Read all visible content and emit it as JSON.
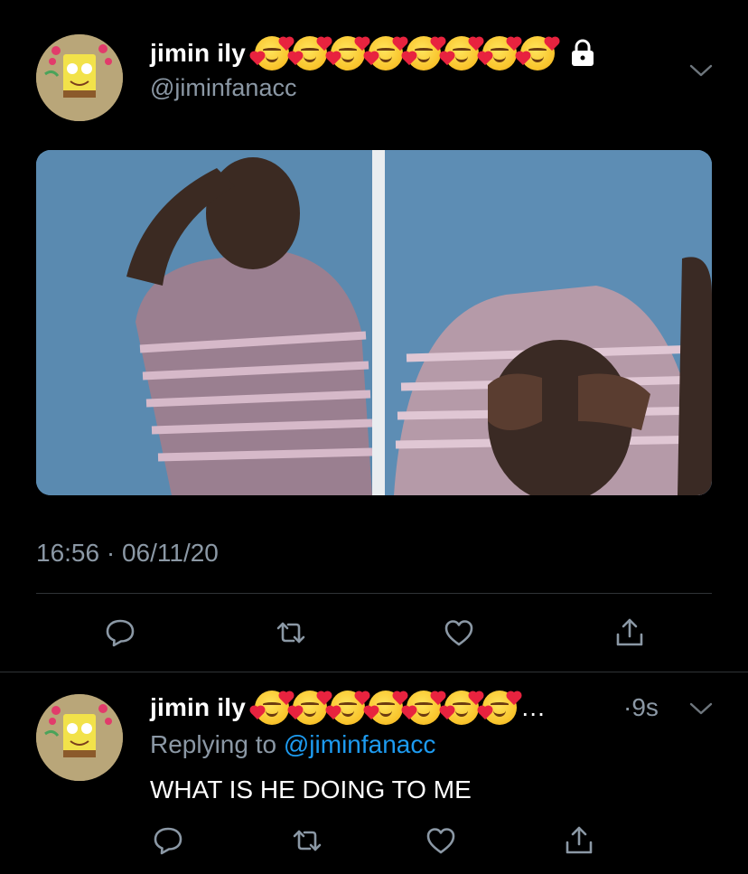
{
  "main_tweet": {
    "display_name": "jimin ily",
    "handle": "@jiminfanacc",
    "emoji_count": 8,
    "emoji_name": "smiling-face-with-hearts",
    "protected_icon": "lock-icon",
    "timestamp": "16:56 · 06/11/20",
    "image_alt_icon": "meme-photo"
  },
  "reply_tweet": {
    "display_name": "jimin ily",
    "emoji_count": 7,
    "ellipsis": "…",
    "time_ago": "·9s",
    "replying_prefix": "Replying to ",
    "replying_handle": "@jiminfanacc",
    "text": "WHAT IS HE DOING TO ME"
  },
  "icons": {
    "reply": "reply-icon",
    "retweet": "retweet-icon",
    "like": "like-icon",
    "share": "share-icon",
    "more": "chevron-down-icon"
  },
  "colors": {
    "background": "#000000",
    "secondary_text": "#8b98a5",
    "link": "#1d9bf0",
    "divider": "#2f3336"
  }
}
